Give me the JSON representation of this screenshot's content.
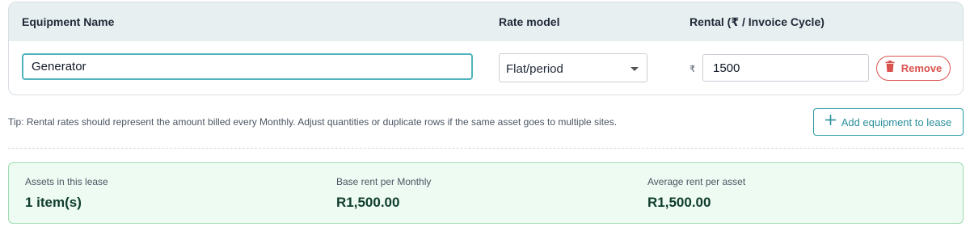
{
  "table": {
    "headers": {
      "equipment_name": "Equipment Name",
      "rate_model": "Rate model",
      "rental": "Rental (₹ / Invoice Cycle)"
    },
    "row": {
      "equipment_name": "Generator",
      "rate_model": "Flat/period",
      "currency_symbol": "₹",
      "rental_amount": "1500",
      "remove_label": "Remove"
    }
  },
  "tip": "Tip: Rental rates should represent the amount billed every Monthly. Adjust quantities or duplicate rows if the same asset goes to multiple sites.",
  "add_button": {
    "label": "Add equipment to lease"
  },
  "summary": {
    "assets": {
      "label": "Assets in this lease",
      "value": "1 item(s)"
    },
    "base_rent": {
      "label": "Base rent per Monthly",
      "value": "R1,500.00"
    },
    "average_rent": {
      "label": "Average rent per asset",
      "value": "R1,500.00"
    }
  },
  "icons": {
    "remove": "trash-icon",
    "add": "plus-icon"
  },
  "colors": {
    "accent": "#2a9aa6",
    "danger": "#d9534f",
    "summary_bg": "#eefbf2",
    "summary_border": "#9fdcb1",
    "header_bg": "#e7eff1"
  }
}
